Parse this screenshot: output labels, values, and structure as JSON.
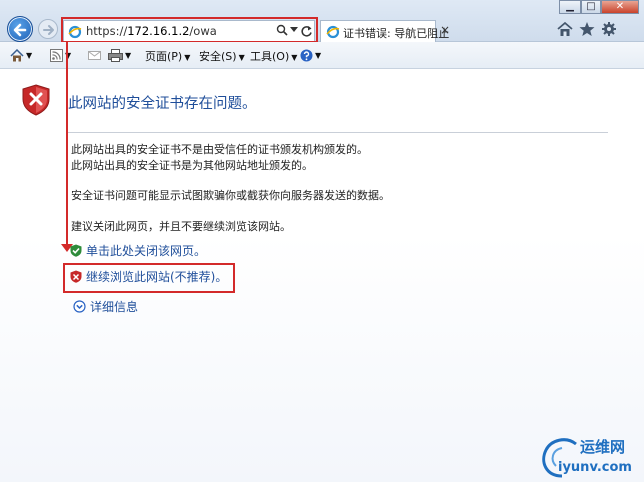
{
  "browser": {
    "url_prefix": "https://",
    "url_host": "172.16.1.2",
    "url_path": "/owa",
    "tab_title": "证书错误: 导航已阻止",
    "tab_close": "×"
  },
  "window_controls": {
    "minimize": "▁",
    "maximize": "□",
    "close": "✕"
  },
  "command_bar": {
    "page": "页面(P)",
    "safety": "安全(S)",
    "tools": "工具(O)"
  },
  "content": {
    "title": "此网站的安全证书存在问题。",
    "line1": "此网站出具的安全证书不是由受信任的证书颁发机构颁发的。",
    "line2": "此网站出具的安全证书是为其他网站地址颁发的。",
    "line3": "安全证书问题可能显示试图欺骗你或截获你向服务器发送的数据。",
    "line4": "建议关闭此网页，并且不要继续浏览该网站。",
    "close_link": "单击此处关闭该网页。",
    "continue_link": "继续浏览此网站(不推荐)。",
    "details_link": "详细信息"
  },
  "watermark": {
    "line1": "运维网",
    "line2": "iyunv.com"
  },
  "colors": {
    "link": "#1f4e9a",
    "highlight_red": "#d32a2a",
    "shield_red": "#c62828"
  }
}
